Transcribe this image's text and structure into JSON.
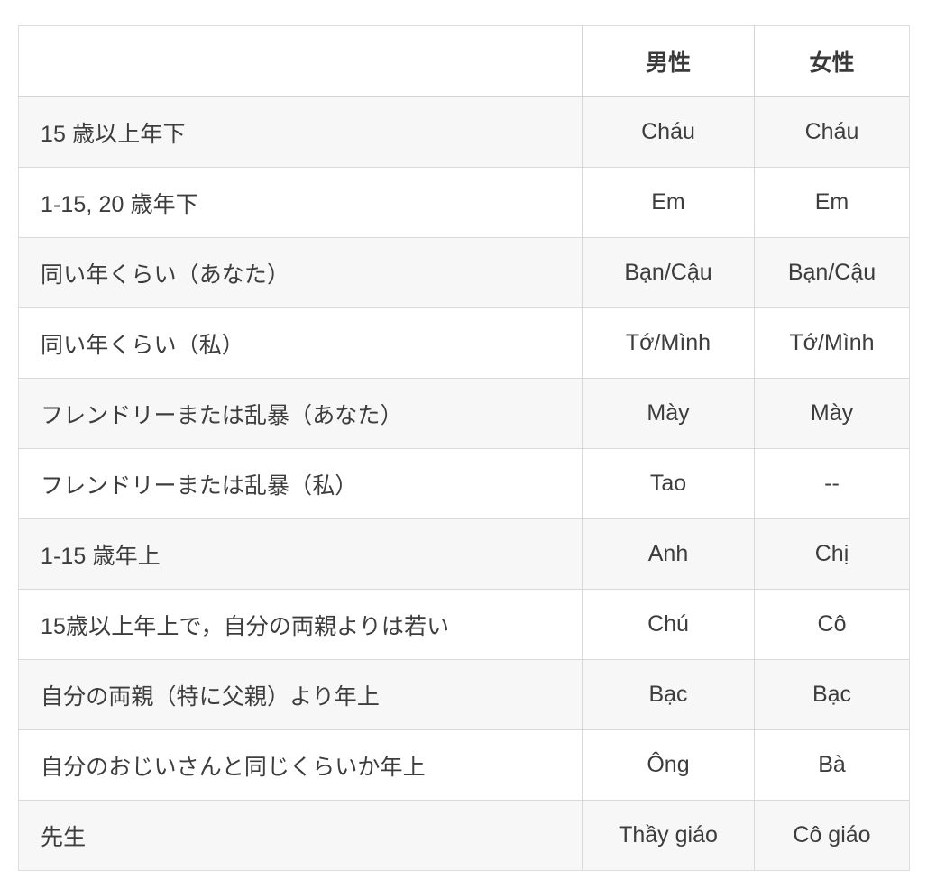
{
  "table": {
    "columns": [
      {
        "key": "description",
        "label": "",
        "align": "left"
      },
      {
        "key": "male",
        "label": "男性",
        "align": "center"
      },
      {
        "key": "female",
        "label": "女性",
        "align": "center"
      }
    ],
    "rows": [
      {
        "description": "15 歳以上年下",
        "male": "Cháu",
        "female": "Cháu"
      },
      {
        "description": "1-15, 20 歳年下",
        "male": "Em",
        "female": "Em"
      },
      {
        "description": "同い年くらい（あなた）",
        "male": "Bạn/Cậu",
        "female": "Bạn/Cậu"
      },
      {
        "description": "同い年くらい（私）",
        "male": "Tớ/Mình",
        "female": "Tớ/Mình"
      },
      {
        "description": "フレンドリーまたは乱暴（あなた）",
        "male": "Mày",
        "female": "Mày"
      },
      {
        "description": "フレンドリーまたは乱暴（私）",
        "male": "Tao",
        "female": "--"
      },
      {
        "description": "1-15 歳年上",
        "male": "Anh",
        "female": "Chị"
      },
      {
        "description": "15歳以上年上で，自分の両親よりは若い",
        "male": "Chú",
        "female": "Cô"
      },
      {
        "description": "自分の両親（特に父親）より年上",
        "male": "Bạc",
        "female": "Bạc"
      },
      {
        "description": "自分のおじいさんと同じくらいか年上",
        "male": "Ông",
        "female": "Bà"
      },
      {
        "description": "先生",
        "male": "Thầy giáo",
        "female": "Cô giáo"
      }
    ]
  },
  "colors": {
    "page_background": "#ffffff",
    "stripe_background": "#f7f7f7",
    "row_background": "#ffffff",
    "border": "#d9d9d9",
    "text": "#3d3d3d"
  }
}
